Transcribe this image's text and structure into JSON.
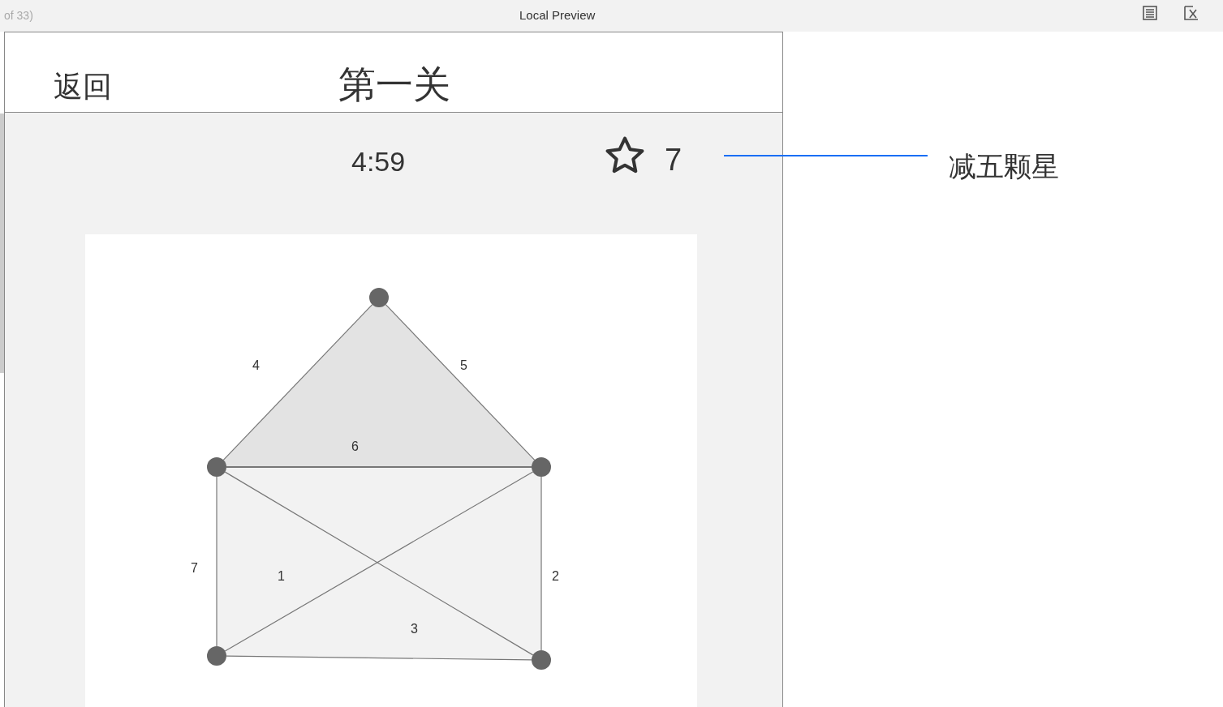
{
  "toolbar": {
    "page_indicator": "of 33)",
    "title": "Local Preview"
  },
  "header": {
    "back": "返回",
    "title": "第一关"
  },
  "status": {
    "timer": "4:59",
    "score": "7"
  },
  "diagram": {
    "edge_labels": [
      "4",
      "5",
      "6",
      "7",
      "1",
      "2",
      "3"
    ]
  },
  "annotation": {
    "text": "减五颗星"
  }
}
